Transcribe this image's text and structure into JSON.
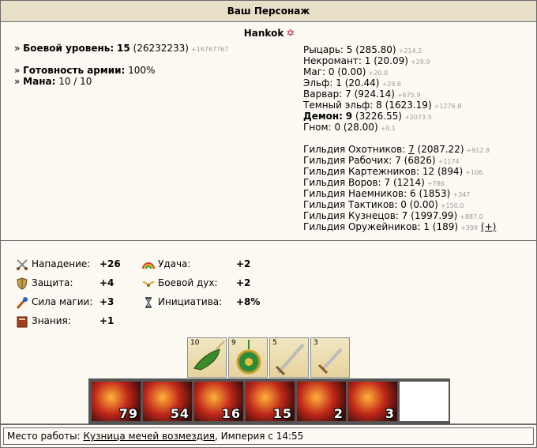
{
  "header": {
    "title": "Ваш Персонаж"
  },
  "hero": {
    "name": "Hankok"
  },
  "left": {
    "combat_level_label": "Боевой уровень:",
    "combat_level": "15",
    "combat_exp": "(26232233)",
    "combat_exp_delta": "+16767767",
    "army_ready_label": "Готовность армии:",
    "army_ready": "100%",
    "mana_label": "Мана:",
    "mana": "10 / 10"
  },
  "factions": [
    {
      "name": "Рыцарь:",
      "level": "5",
      "points": "(285.80)",
      "delta": "+214.2",
      "bold": false
    },
    {
      "name": "Некромант:",
      "level": "1",
      "points": "(20.09)",
      "delta": "+29.9",
      "bold": false
    },
    {
      "name": "Маг:",
      "level": "0",
      "points": "(0.00)",
      "delta": "+20.0",
      "bold": false
    },
    {
      "name": "Эльф:",
      "level": "1",
      "points": "(20.44)",
      "delta": "+29.6",
      "bold": false
    },
    {
      "name": "Варвар:",
      "level": "7",
      "points": "(924.14)",
      "delta": "+675.9",
      "bold": false
    },
    {
      "name": "Темный эльф:",
      "level": "8",
      "points": "(1623.19)",
      "delta": "+1276.8",
      "bold": false
    },
    {
      "name": "Демон:",
      "level": "9",
      "points": "(3226.55)",
      "delta": "+2073.5",
      "bold": true
    },
    {
      "name": "Гном:",
      "level": "0",
      "points": "(28.00)",
      "delta": "+0.1",
      "bold": false
    }
  ],
  "guilds": [
    {
      "name": "Гильдия Охотников:",
      "level": "7",
      "points": "(2087.22)",
      "delta": "+912.8",
      "link": true
    },
    {
      "name": "Гильдия Рабочих:",
      "level": "7",
      "points": "(6826)",
      "delta": "+1174",
      "link": false
    },
    {
      "name": "Гильдия Картежников:",
      "level": "12",
      "points": "(894)",
      "delta": "+106",
      "link": false
    },
    {
      "name": "Гильдия Воров:",
      "level": "7",
      "points": "(1214)",
      "delta": "+786",
      "link": false
    },
    {
      "name": "Гильдия Наемников:",
      "level": "6",
      "points": "(1853)",
      "delta": "+347",
      "link": false
    },
    {
      "name": "Гильдия Тактиков:",
      "level": "0",
      "points": "(0.00)",
      "delta": "+150.0",
      "link": false
    },
    {
      "name": "Гильдия Кузнецов:",
      "level": "7",
      "points": "(1997.99)",
      "delta": "+887.0",
      "link": false
    },
    {
      "name": "Гильдия Оружейников:",
      "level": "1",
      "points": "(189)",
      "delta": "+399",
      "link": false
    }
  ],
  "guild_plus": "(+)",
  "stats_left": [
    {
      "icon": "sword-icon",
      "label": "Нападение:",
      "value": "+26"
    },
    {
      "icon": "shield-icon",
      "label": "Защита:",
      "value": "+4"
    },
    {
      "icon": "wand-icon",
      "label": "Сила магии:",
      "value": "+3"
    },
    {
      "icon": "book-icon",
      "label": "Знания:",
      "value": "+1"
    }
  ],
  "stats_right": [
    {
      "icon": "rainbow-icon",
      "label": "Удача:",
      "value": "+2"
    },
    {
      "icon": "wings-icon",
      "label": "Боевой дух:",
      "value": "+2"
    },
    {
      "icon": "hourglass-icon",
      "label": "Инициатива:",
      "value": "+8%"
    }
  ],
  "artifacts": [
    {
      "name": "hat",
      "level": "10"
    },
    {
      "name": "amulet",
      "level": "9"
    },
    {
      "name": "sword",
      "level": "5"
    },
    {
      "name": "dagger",
      "level": "3"
    }
  ],
  "troops": [
    {
      "name": "troop-1",
      "count": "79"
    },
    {
      "name": "troop-2",
      "count": "54"
    },
    {
      "name": "troop-3",
      "count": "16"
    },
    {
      "name": "troop-4",
      "count": "15"
    },
    {
      "name": "troop-5",
      "count": "2"
    },
    {
      "name": "troop-6",
      "count": "3"
    }
  ],
  "footer": {
    "work_label": "Место работы:",
    "work_place": "Кузница мечей возмездия",
    "work_suffix": ", Империя с 14:55"
  }
}
